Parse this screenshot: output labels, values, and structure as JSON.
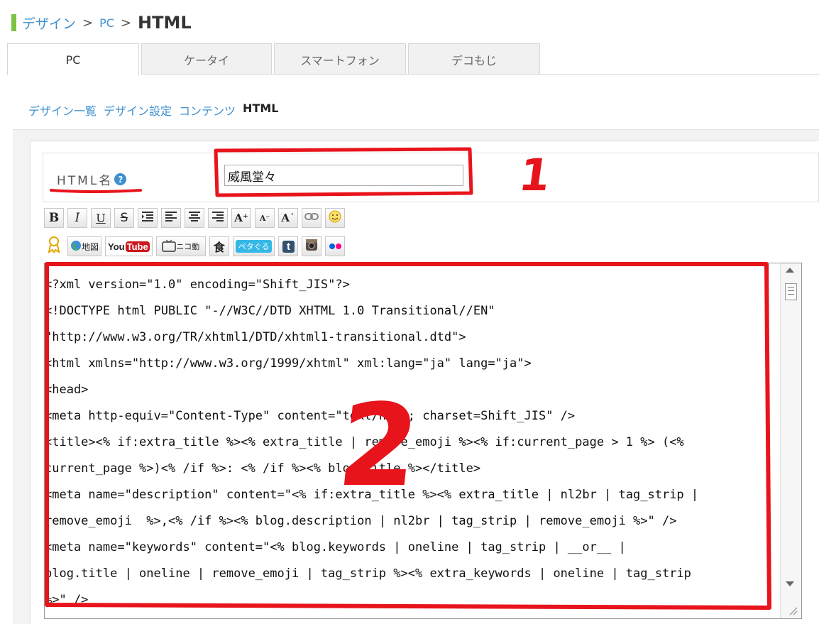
{
  "breadcrumb": {
    "items": [
      "デザイン",
      "PC"
    ],
    "separator": ">",
    "current": "HTML"
  },
  "tabs": [
    "PC",
    "ケータイ",
    "スマートフォン",
    "デコもじ"
  ],
  "subnav": [
    "デザイン一覧",
    "デザイン設定",
    "コンテンツ",
    "HTML"
  ],
  "form": {
    "name_label": "HTML名",
    "help": "?",
    "name_value": "威風堂々"
  },
  "toolbar1": [
    "B",
    "I",
    "U",
    "S",
    "align-justify-icon",
    "align-left-icon",
    "align-center-icon",
    "align-right-icon",
    "A⁺",
    "A⁻",
    "A˙",
    "link-icon",
    "smile-icon"
  ],
  "toolbar2": {
    "map": "地図",
    "youtube_you": "You",
    "youtube_tube": "Tube",
    "nico": "ニコ動",
    "food": "食",
    "peta": "ペタぐる",
    "tumblr": "t"
  },
  "code_lines": [
    "<?xml version=\"1.0\" encoding=\"Shift_JIS\"?>",
    "<!DOCTYPE html PUBLIC \"-//W3C//DTD XHTML 1.0 Transitional//EN\"",
    "\"http://www.w3.org/TR/xhtml1/DTD/xhtml1-transitional.dtd\">",
    "<html xmlns=\"http://www.w3.org/1999/xhtml\" xml:lang=\"ja\" lang=\"ja\">",
    "<head>",
    "<meta http-equiv=\"Content-Type\" content=\"text/html; charset=Shift_JIS\" />",
    "<title><% if:extra_title %><% extra_title | remove_emoji %><% if:current_page > 1 %> (<%",
    "current_page %>)<% /if %>: <% /if %><% blog.title %></title>",
    "<meta name=\"description\" content=\"<% if:extra_title %><% extra_title | nl2br | tag_strip |",
    "remove_emoji  %>,<% /if %><% blog.description | nl2br | tag_strip | remove_emoji %>\" />",
    "<meta name=\"keywords\" content=\"<% blog.keywords | oneline | tag_strip | __or__ |",
    "blog.title | oneline | remove_emoji | tag_strip %><% extra_keywords | oneline | tag_strip",
    "%>\" />"
  ],
  "annotations": [
    "1",
    "2"
  ],
  "colors": {
    "link": "#3d8fd0",
    "accent_green": "#7cc243",
    "annotation_red": "#e8141c"
  }
}
